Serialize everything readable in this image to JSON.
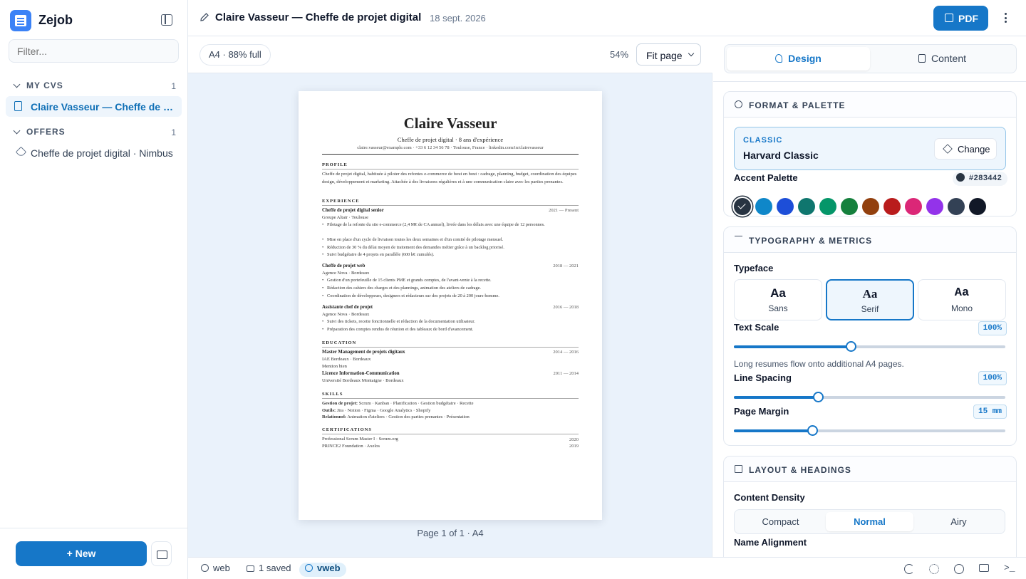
{
  "app": {
    "name": "Zejob"
  },
  "sidebar": {
    "filter_placeholder": "Filter...",
    "sections": [
      {
        "title": "MY CVS",
        "count": "1",
        "items": [
          "Claire Vasseur — Cheffe de projet digital"
        ]
      },
      {
        "title": "OFFERS",
        "count": "1",
        "items": [
          "Cheffe de projet digital · Nimbus"
        ]
      }
    ],
    "new_label": "+ New"
  },
  "header": {
    "title": "Claire Vasseur — Cheffe de projet digital",
    "date": "18 sept. 2026",
    "pdf_label": "PDF"
  },
  "preview": {
    "fill_chip": "A4 · 88% full",
    "zoom": "54%",
    "fit_select": "Fit page",
    "page_footer": "Page 1 of 1 · A4"
  },
  "resume": {
    "name": "Claire Vasseur",
    "subtitle": "Cheffe de projet digital · 8 ans d'expérience",
    "contact": "claire.vasseur@example.com  ·  +33 6 12 34 56 78  ·  Toulouse, France  ·  linkedin.com/in/clairevasseur",
    "profile_h": "PROFILE",
    "profile": "Cheffe de projet digital, habituée à piloter des refontes e-commerce de bout en bout : cadrage, planning, budget, coordination des équipes design, développement et marketing. Attachée à des livraisons régulières et à une communication claire avec les parties prenantes.",
    "experience_h": "EXPERIENCE",
    "jobs": [
      {
        "title": "Cheffe de projet digital senior",
        "company": "Groupe Altair · Toulouse",
        "dates": "2021 — Present",
        "bullets": [
          "Pilotage de la refonte du site e-commerce (2,4 M€ de CA annuel), livrée dans les délais avec une équipe de 12 personnes.",
          "Mise en place d'un cycle de livraison toutes les deux semaines et d'un comité de pilotage mensuel.",
          "Réduction de 30 % du délai moyen de traitement des demandes métier grâce à un backlog priorisé.",
          "Suivi budgétaire de 4 projets en parallèle (600 k€ cumulés)."
        ]
      },
      {
        "title": "Cheffe de projet web",
        "company": "Agence Nova · Bordeaux",
        "dates": "2018 — 2021",
        "bullets": [
          "Gestion d'un portefeuille de 15 clients PME et grands comptes, de l'avant-vente à la recette.",
          "Rédaction des cahiers des charges et des plannings, animation des ateliers de cadrage.",
          "Coordination de développeurs, designers et rédacteurs sur des projets de 20 à 200 jours-homme."
        ]
      },
      {
        "title": "Assistante chef de projet",
        "company": "Agence Nova · Bordeaux",
        "dates": "2016 — 2018",
        "bullets": [
          "Suivi des tickets, recette fonctionnelle et rédaction de la documentation utilisateur.",
          "Préparation des comptes rendus de réunion et des tableaux de bord d'avancement."
        ]
      }
    ],
    "education_h": "EDUCATION",
    "education": [
      {
        "title": "Master Management de projets digitaux",
        "school": "IAE Bordeaux · Bordeaux",
        "note": "Mention bien",
        "dates": "2014 — 2016"
      },
      {
        "title": "Licence Information-Communication",
        "school": "Université Bordeaux Montaigne · Bordeaux",
        "note": "",
        "dates": "2011 — 2014"
      }
    ],
    "skills_h": "SKILLS",
    "skills": [
      {
        "k": "Gestion de projet:",
        "v": " Scrum · Kanban · Planification · Gestion budgétaire · Recette"
      },
      {
        "k": "Outils:",
        "v": " Jira · Notion · Figma · Google Analytics · Shopify"
      },
      {
        "k": "Relationnel:",
        "v": " Animation d'ateliers · Gestion des parties prenantes · Présentation"
      }
    ],
    "certs_h": "CERTIFICATIONS",
    "certs": [
      {
        "name": "Professional Scrum Master I · Scrum.org",
        "year": "2020"
      },
      {
        "name": "PRINCE2 Foundation · Axelos",
        "year": "2019"
      }
    ]
  },
  "statusbar": {
    "web": "web",
    "saved": "1 saved",
    "vweb": "vweb"
  },
  "panel": {
    "tabs": [
      "Design",
      "Content"
    ],
    "format": {
      "title": "FORMAT & PALETTE",
      "template_class": "CLASSIC",
      "template_name": "Harvard Classic",
      "change_label": "Change",
      "accent_label": "Accent Palette",
      "accent_hex": "#283442",
      "swatches": [
        "#283442",
        "#0f87c9",
        "#1d4ed8",
        "#0f766e",
        "#059669",
        "#15803d",
        "#92400e",
        "#b91c1c",
        "#db2777",
        "#9333ea",
        "#334155",
        "#111827"
      ]
    },
    "typography": {
      "title": "TYPOGRAPHY & METRICS",
      "typeface_label": "Typeface",
      "faces": [
        {
          "aa": "Aa",
          "name": "Sans"
        },
        {
          "aa": "Aa",
          "name": "Serif"
        },
        {
          "aa": "Aa",
          "name": "Mono"
        }
      ],
      "selected_face": "Serif",
      "text_scale_label": "Text Scale",
      "text_scale_value": "100%",
      "text_scale_level": 0.43,
      "hint": "Long resumes flow onto additional A4 pages.",
      "line_spacing_label": "Line Spacing",
      "line_spacing_value": "100%",
      "line_spacing_level": 0.31,
      "margin_label": "Page Margin",
      "margin_value": "15 mm",
      "margin_level": 0.29
    },
    "layout": {
      "title": "LAYOUT & HEADINGS",
      "density_label": "Content Density",
      "density_options": [
        "Compact",
        "Normal",
        "Airy"
      ],
      "density_selected": "Normal",
      "name_align_label": "Name Alignment"
    }
  }
}
